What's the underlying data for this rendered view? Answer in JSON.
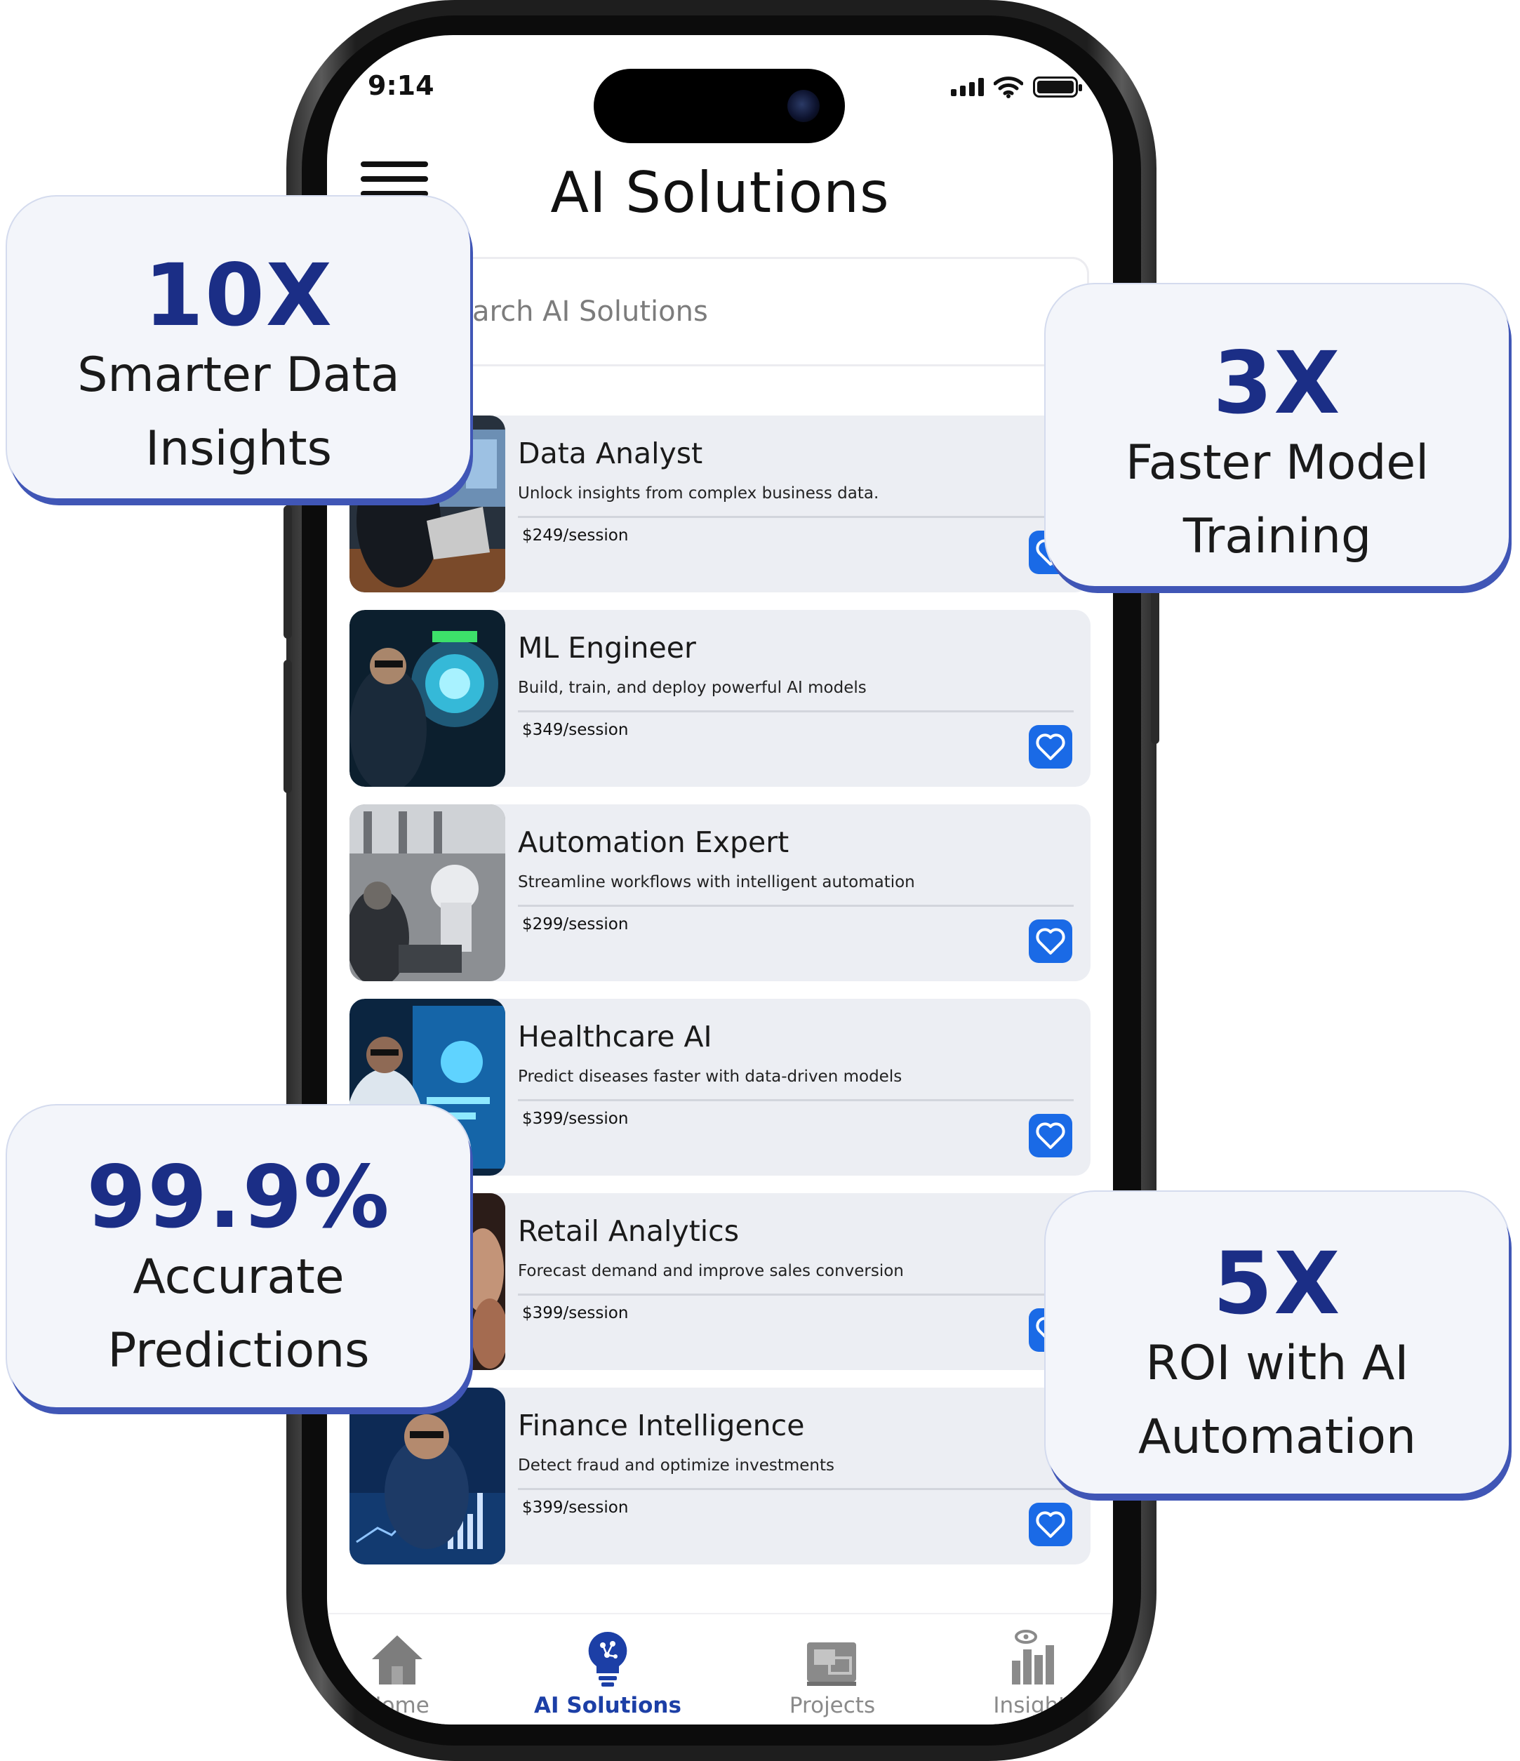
{
  "status_bar": {
    "time": "9:14"
  },
  "header": {
    "title": "AI Solutions"
  },
  "search": {
    "placeholder": "Search AI Solutions"
  },
  "cards": [
    {
      "title": "Data Analyst",
      "description": "Unlock insights from complex business data.",
      "price": "$249/session"
    },
    {
      "title": "ML Engineer",
      "description": "Build, train, and deploy powerful AI models",
      "price": "$349/session"
    },
    {
      "title": "Automation Expert",
      "description": "Streamline workflows with intelligent automation",
      "price": "$299/session"
    },
    {
      "title": "Healthcare AI",
      "description": "Predict diseases faster with data-driven models",
      "price": "$399/session"
    },
    {
      "title": "Retail Analytics",
      "description": "Forecast demand and improve sales conversion",
      "price": "$399/session"
    },
    {
      "title": "Finance Intelligence",
      "description": "Detect fraud and optimize investments",
      "price": "$399/session"
    }
  ],
  "tabbar": {
    "items": [
      {
        "label": "Home",
        "icon": "home-icon"
      },
      {
        "label": "AI Solutions",
        "icon": "ai-bulb-icon",
        "active": true
      },
      {
        "label": "Projects",
        "icon": "projects-icon"
      },
      {
        "label": "Insights",
        "icon": "insights-icon"
      }
    ]
  },
  "stats": [
    {
      "value": "10X",
      "line1": "Smarter Data",
      "line2": "Insights"
    },
    {
      "value": "3X",
      "line1": "Faster Model",
      "line2": "Training"
    },
    {
      "value": "99.9%",
      "line1": "Accurate",
      "line2": "Predictions"
    },
    {
      "value": "5X",
      "line1": "ROI with AI",
      "line2": "Automation"
    }
  ],
  "colors": {
    "accent_blue": "#1a6ae6",
    "stat_navy": "#1b2e86",
    "card_bg": "#eceef3",
    "tab_active": "#1c3fa6"
  }
}
